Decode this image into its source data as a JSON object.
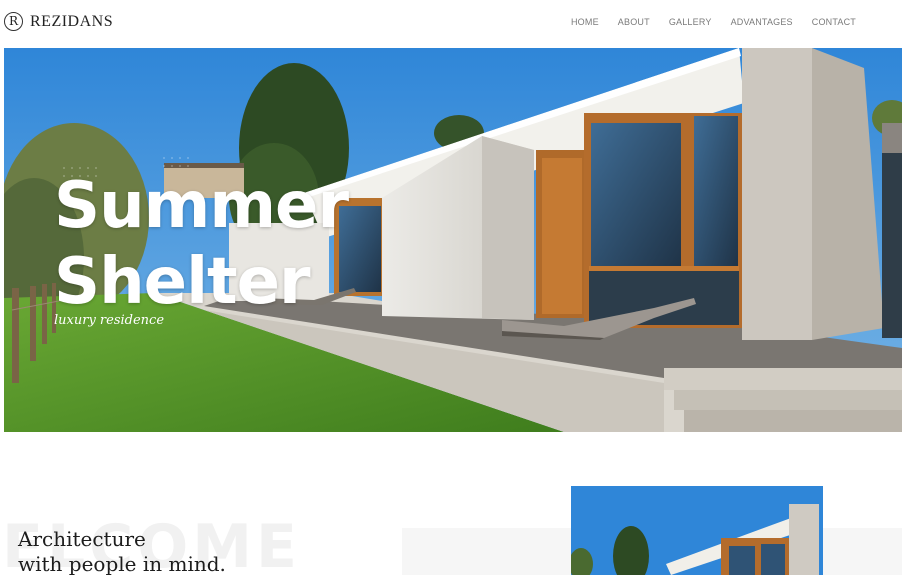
{
  "header": {
    "logo_letter": "R",
    "brand": "REZIDANS",
    "nav": [
      "HOME",
      "ABOUT",
      "GALLERY",
      "ADVANTAGES",
      "CONTACT"
    ]
  },
  "hero": {
    "title_line1": "Summer",
    "title_line2": "Shelter",
    "subtitle": "luxury residence"
  },
  "welcome": {
    "background_word": "ELCOME",
    "heading_line1": "Architecture",
    "heading_line2": "with people in mind."
  },
  "colors": {
    "sky": "#3c8fd6",
    "grass": "#5d9b2d",
    "concrete": "#d9d4cc",
    "text_dark": "#1d1d1d",
    "nav_grey": "#7a7a7a"
  }
}
